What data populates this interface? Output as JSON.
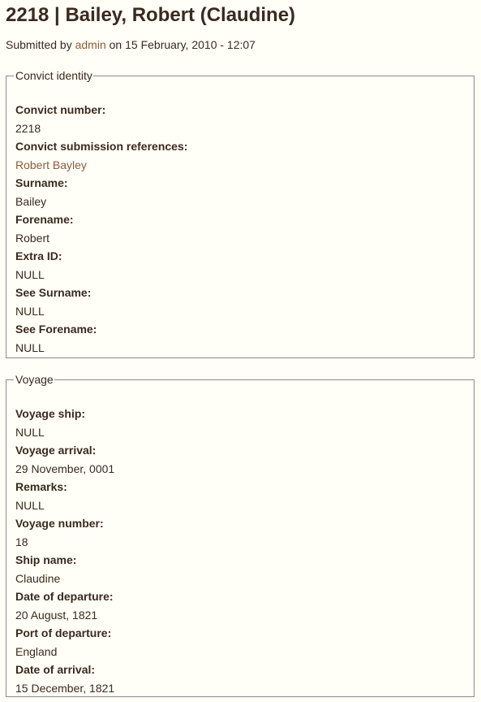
{
  "page": {
    "title": "2218 | Bailey, Robert (Claudine)",
    "submitted_prefix": "Submitted by",
    "submitted_user": "admin",
    "submitted_on": "on",
    "submitted_date": "15 February, 2010 - 12:07"
  },
  "identity": {
    "legend": "Convict identity",
    "fields": [
      {
        "label": "Convict number:",
        "value": "2218"
      },
      {
        "label": "Convict submission references:",
        "value": "Robert Bayley"
      },
      {
        "label": "Surname:",
        "value": "Bailey"
      },
      {
        "label": "Forename:",
        "value": "Robert"
      },
      {
        "label": "Extra ID:",
        "value": "NULL"
      },
      {
        "label": "See Surname:",
        "value": "NULL"
      },
      {
        "label": "See Forename:",
        "value": "NULL"
      }
    ]
  },
  "voyage": {
    "legend": "Voyage",
    "fields": [
      {
        "label": "Voyage ship:",
        "value": "NULL"
      },
      {
        "label": "Voyage arrival:",
        "value": "29 November, 0001"
      },
      {
        "label": "Remarks:",
        "value": "NULL"
      },
      {
        "label": "Voyage number:",
        "value": "18"
      },
      {
        "label": "Ship name:",
        "value": "Claudine"
      },
      {
        "label": "Date of departure:",
        "value": "20 August, 1821"
      },
      {
        "label": "Port of departure:",
        "value": "England"
      },
      {
        "label": "Date of arrival:",
        "value": "15 December, 1821"
      }
    ]
  },
  "colors": {
    "background": "#fffef7",
    "text": "#3a2a1f",
    "link": "#8a5e3b",
    "border": "#8c8c8c"
  }
}
